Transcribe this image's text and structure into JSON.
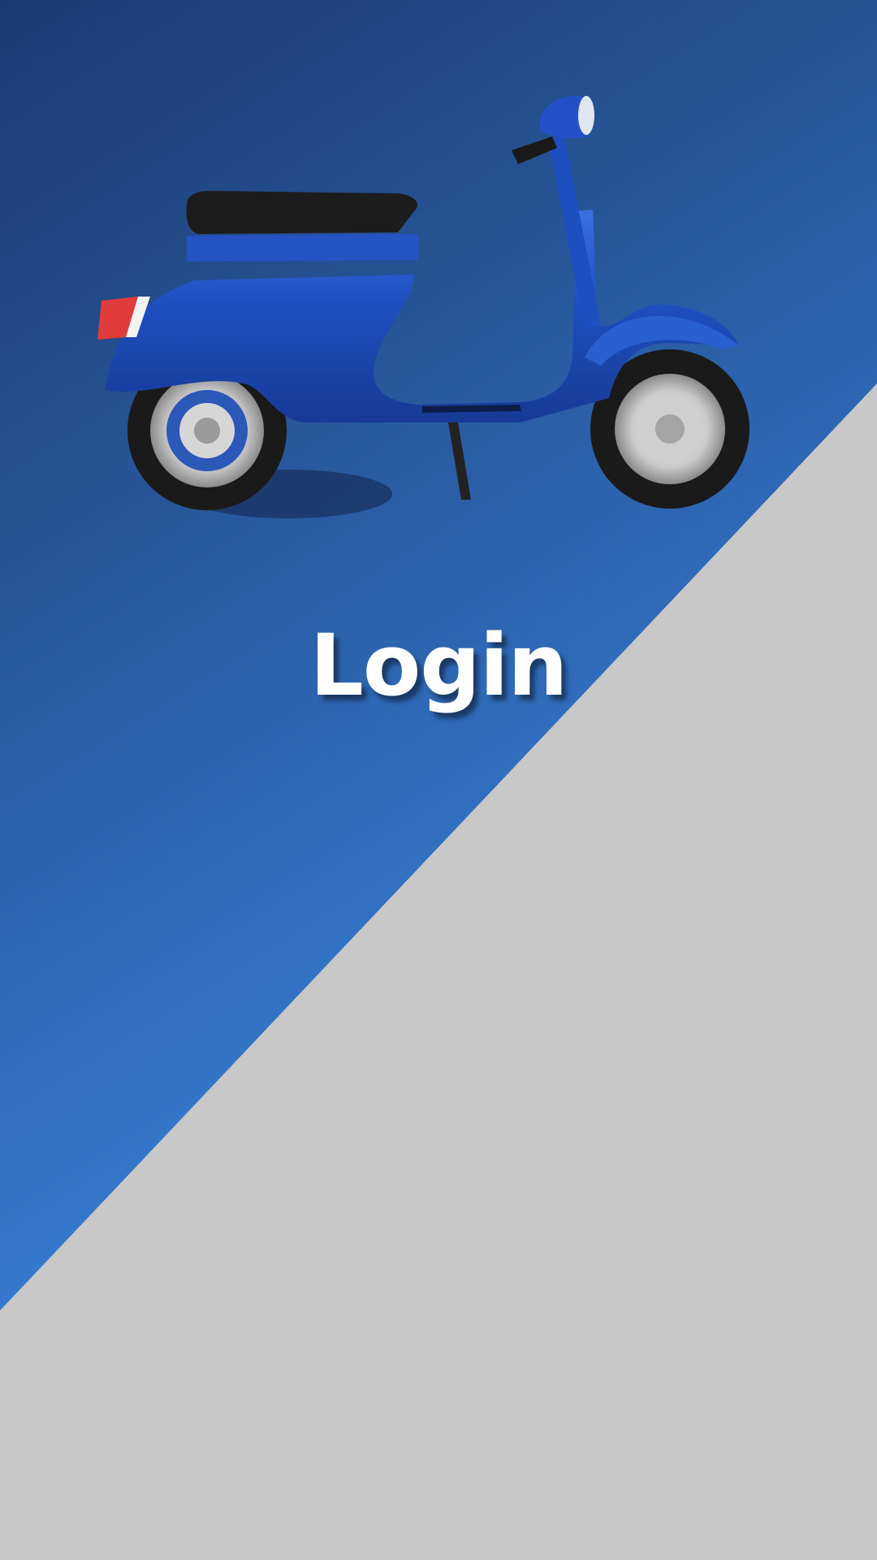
{
  "screen": {
    "title": "Login"
  },
  "colors": {
    "background_gray": "#c8c8c9",
    "gradient_dark": "#1b3a73",
    "gradient_light": "#3a7fd6",
    "scooter_body": "#1e4fc0",
    "title_text": "#ffffff"
  },
  "illustration": {
    "name": "scooter-illustration"
  }
}
